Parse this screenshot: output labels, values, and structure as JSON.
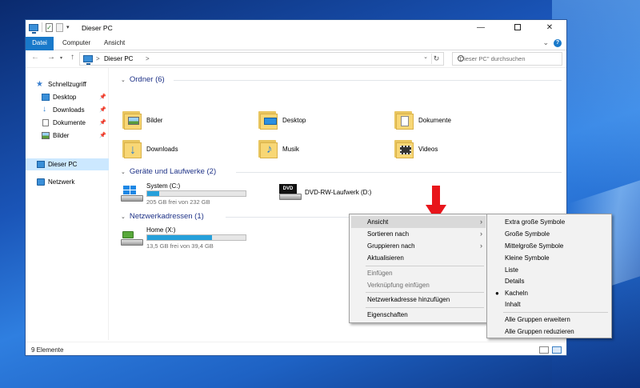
{
  "window": {
    "title": "Dieser PC",
    "controls": {
      "minimize": "—",
      "close": "✕"
    }
  },
  "ribbon": {
    "tabs": [
      "Datei",
      "Computer",
      "Ansicht"
    ]
  },
  "address": {
    "sep1": ">",
    "crumb": "Dieser PC",
    "sep2": ">",
    "search_placeholder": "\"Dieser PC\" durchsuchen"
  },
  "navpane": {
    "items": [
      {
        "label": "Schnellzugriff",
        "icon": "star-icon"
      },
      {
        "label": "Desktop",
        "icon": "desktop-folder-icon",
        "pinned": true
      },
      {
        "label": "Downloads",
        "icon": "download-icon",
        "pinned": true
      },
      {
        "label": "Dokumente",
        "icon": "document-icon",
        "pinned": true
      },
      {
        "label": "Bilder",
        "icon": "pictures-icon",
        "pinned": true
      },
      {
        "label": "Dieser PC",
        "icon": "computer-icon",
        "selected": true
      },
      {
        "label": "Netzwerk",
        "icon": "network-icon"
      }
    ]
  },
  "groups": {
    "folders": {
      "header": "Ordner (6)",
      "items": [
        "Bilder",
        "Desktop",
        "Dokumente",
        "Downloads",
        "Musik",
        "Videos"
      ]
    },
    "devices": {
      "header": "Geräte und Laufwerke (2)",
      "items": [
        {
          "label": "System (C:)",
          "capacity": "205 GB frei von 232 GB",
          "used_fraction": 0.12
        },
        {
          "label": "DVD-RW-Laufwerk (D:)",
          "dvd_text": "DVD"
        }
      ]
    },
    "network": {
      "header": "Netzwerkadressen (1)",
      "items": [
        {
          "label": "Home (X:)",
          "capacity": "13,5 GB frei von 39,4 GB",
          "used_fraction": 0.66
        }
      ]
    }
  },
  "status": {
    "item_count": "9 Elemente"
  },
  "context_menu": {
    "items": [
      {
        "label": "Ansicht",
        "submenu": true,
        "hot": true
      },
      {
        "label": "Sortieren nach",
        "submenu": true
      },
      {
        "label": "Gruppieren nach",
        "submenu": true
      },
      {
        "label": "Aktualisieren"
      },
      {
        "label": "Einfügen",
        "disabled": true
      },
      {
        "label": "Verknüpfung einfügen",
        "disabled": true
      },
      {
        "label": "Netzwerkadresse hinzufügen"
      },
      {
        "label": "Eigenschaften"
      }
    ]
  },
  "view_submenu": {
    "items": [
      {
        "label": "Extra große Symbole"
      },
      {
        "label": "Große Symbole"
      },
      {
        "label": "Mittelgroße Symbole"
      },
      {
        "label": "Kleine Symbole"
      },
      {
        "label": "Liste"
      },
      {
        "label": "Details"
      },
      {
        "label": "Kacheln",
        "checked": true
      },
      {
        "label": "Inhalt"
      },
      {
        "label": "Alle Gruppen erweitern"
      },
      {
        "label": "Alle Gruppen reduzieren"
      }
    ]
  },
  "colors": {
    "accent": "#1979ca",
    "group_header": "#1e3287",
    "capacity_fill": "#26a0da",
    "annotation_arrow": "#e8151b"
  }
}
